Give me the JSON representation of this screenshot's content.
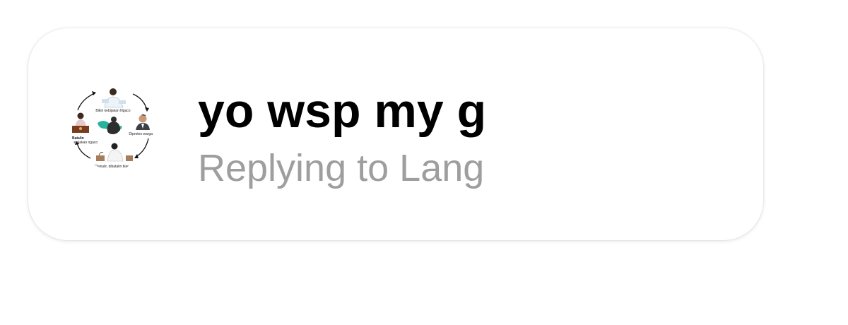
{
  "message": {
    "title": "yo wsp my g",
    "subtitle": "Replying to Lang"
  },
  "avatar": {
    "icon": "cycle-diagram-avatar",
    "captions": {
      "top": "Bikin kebijakan Ngaco",
      "right": "Diprotes warga",
      "bottom": "Dianulir, dibatalin biar...",
      "left_line1": "Batalin",
      "left_line2": "kebijakan ngaco"
    }
  },
  "colors": {
    "title": "#000000",
    "subtitle": "#9e9e9e",
    "card_background": "#ffffff"
  }
}
